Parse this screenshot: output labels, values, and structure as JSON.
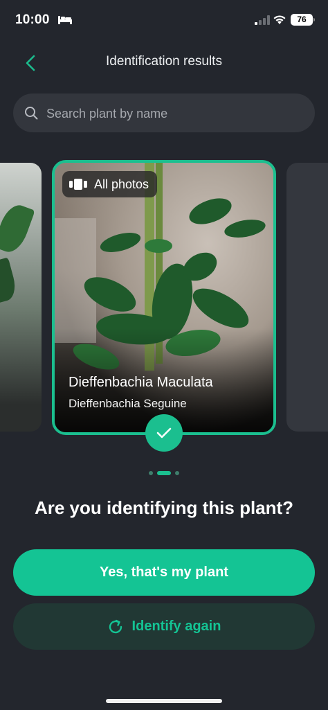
{
  "status_bar": {
    "time": "10:00",
    "battery": "76"
  },
  "header": {
    "title": "Identification results"
  },
  "search": {
    "placeholder": "Search plant by name"
  },
  "card": {
    "all_photos_label": "All photos",
    "common_name": "Dieffenbachia Maculata",
    "scientific_name": "Dieffenbachia Seguine"
  },
  "carousel": {
    "page_count": 3,
    "active_index": 1
  },
  "prompt": {
    "question": "Are you identifying this plant?"
  },
  "actions": {
    "confirm_label": "Yes, that's my plant",
    "retry_label": "Identify again"
  },
  "colors": {
    "accent": "#1bbf8f",
    "background": "#23262d",
    "surface": "#33363d"
  }
}
